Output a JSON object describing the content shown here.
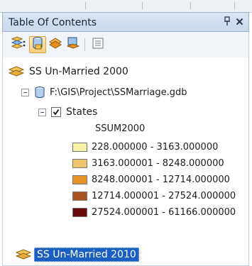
{
  "window": {
    "title": "Table Of Contents",
    "pin_glyph": "p",
    "close_glyph": "×"
  },
  "toolbar": {
    "buttons": [
      {
        "icon": "list-by-drawing-order-icon",
        "active": false
      },
      {
        "icon": "list-by-source-icon",
        "active": true
      },
      {
        "icon": "list-by-visibility-icon",
        "active": false
      },
      {
        "icon": "list-by-selection-icon",
        "active": false
      },
      {
        "icon": "options-icon",
        "active": false
      }
    ]
  },
  "tree": {
    "dataframe_1": {
      "label": "SS Un-Married 2000"
    },
    "workspace": {
      "label": "F:\\GIS\\Project\\SSMarriage.gdb"
    },
    "layer": {
      "label": "States",
      "checked": true
    },
    "field": {
      "label": "SSUM2000"
    },
    "legend": [
      {
        "label": "228.000000 - 3163.000000",
        "color": "#f7f3a8"
      },
      {
        "label": "3163.000001 - 8248.000000",
        "color": "#f0c46a"
      },
      {
        "label": "8248.000001 - 12714.000000",
        "color": "#e79427"
      },
      {
        "label": "12714.000001 - 27524.000000",
        "color": "#a8531e"
      },
      {
        "label": "27524.000001 - 61166.000000",
        "color": "#6b0a0a"
      }
    ],
    "dataframe_2": {
      "label": "SS Un-Married 2010",
      "selected": true
    }
  },
  "colors": {
    "selection": "#1c5fc2",
    "titlebar": "#c8d7ea"
  }
}
